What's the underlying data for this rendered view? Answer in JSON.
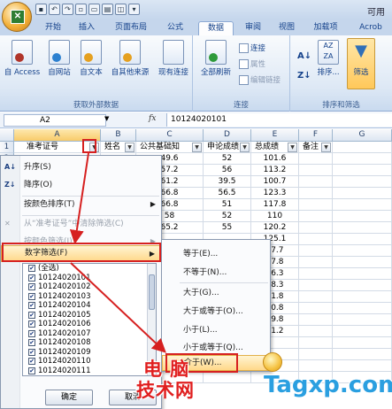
{
  "titlebar": {
    "app_title": "可用",
    "qat": [
      "save",
      "undo",
      "redo",
      "new",
      "open",
      "print",
      "preview",
      "more"
    ]
  },
  "tabs": [
    "开始",
    "插入",
    "页面布局",
    "公式",
    "数据",
    "审阅",
    "视图",
    "加载项",
    "Acrob"
  ],
  "active_tab": "数据",
  "ribbon": {
    "group1": {
      "label": "获取外部数据",
      "buttons": [
        "自 Access",
        "自网站",
        "自文本",
        "自其他来源",
        "现有连接"
      ]
    },
    "group2": {
      "label": "连接",
      "refresh": "全部刷新",
      "small": [
        "连接",
        "属性",
        "编辑链接"
      ]
    },
    "group3": {
      "label": "排序和筛选",
      "sort": "排序...",
      "filter": "筛选"
    }
  },
  "formula_bar": {
    "name_box": "A2",
    "fx": "fx",
    "value": "10124020101"
  },
  "columns": [
    "A",
    "B",
    "C",
    "D",
    "E",
    "F",
    "G"
  ],
  "header_row": [
    "准考证号",
    "姓名",
    "公共基础知",
    "申论成绩",
    "总成绩",
    "备注"
  ],
  "rows": [
    [
      "49.6",
      "52",
      "101.6"
    ],
    [
      "57.2",
      "56",
      "113.2"
    ],
    [
      "61.2",
      "39.5",
      "100.7"
    ],
    [
      "66.8",
      "56.5",
      "123.3"
    ],
    [
      "66.8",
      "51",
      "117.8"
    ],
    [
      "58",
      "52",
      "110"
    ],
    [
      "65.2",
      "55",
      "120.2"
    ],
    [
      "",
      "",
      "125.1"
    ],
    [
      "",
      "",
      "07.7"
    ],
    [
      "",
      "",
      "97.8"
    ],
    [
      "",
      "",
      "06.3"
    ],
    [
      "",
      "",
      "18.3"
    ],
    [
      "",
      "",
      "11.8"
    ],
    [
      "",
      "",
      "10.8"
    ],
    [
      "",
      "",
      "19.8"
    ],
    [
      "",
      "",
      "11.2"
    ],
    [
      "",
      "",
      ""
    ],
    [
      "",
      "",
      ""
    ],
    [
      "",
      "",
      ""
    ],
    [
      "",
      "",
      ""
    ]
  ],
  "filter_menu": {
    "sort_asc": "升序(S)",
    "sort_desc": "降序(O)",
    "sort_color": "按颜色排序(T)",
    "clear_filter": "从“准考证号”中清除筛选(C)",
    "filter_color": "按颜色筛选(I)",
    "number_filter": "数字筛选(F)",
    "list": [
      "(全选)",
      "10124020101",
      "10124020102",
      "10124020103",
      "10124020104",
      "10124020105",
      "10124020106",
      "10124020107",
      "10124020108",
      "10124020109",
      "10124020110",
      "10124020111"
    ],
    "ok": "确定",
    "cancel": "取消"
  },
  "submenu": [
    "等于(E)...",
    "不等于(N)...",
    "大于(G)...",
    "大于或等于(O)...",
    "小于(L)...",
    "小于或等于(Q)...",
    "介于(W)..."
  ],
  "watermark": {
    "cn_line1": "电 脑",
    "cn_line2": "技术网",
    "en": "Tagxp.com"
  },
  "colors": {
    "annotation": "#d62020",
    "hot": "#ffd88a",
    "ribbon": "#c5d6ec"
  }
}
